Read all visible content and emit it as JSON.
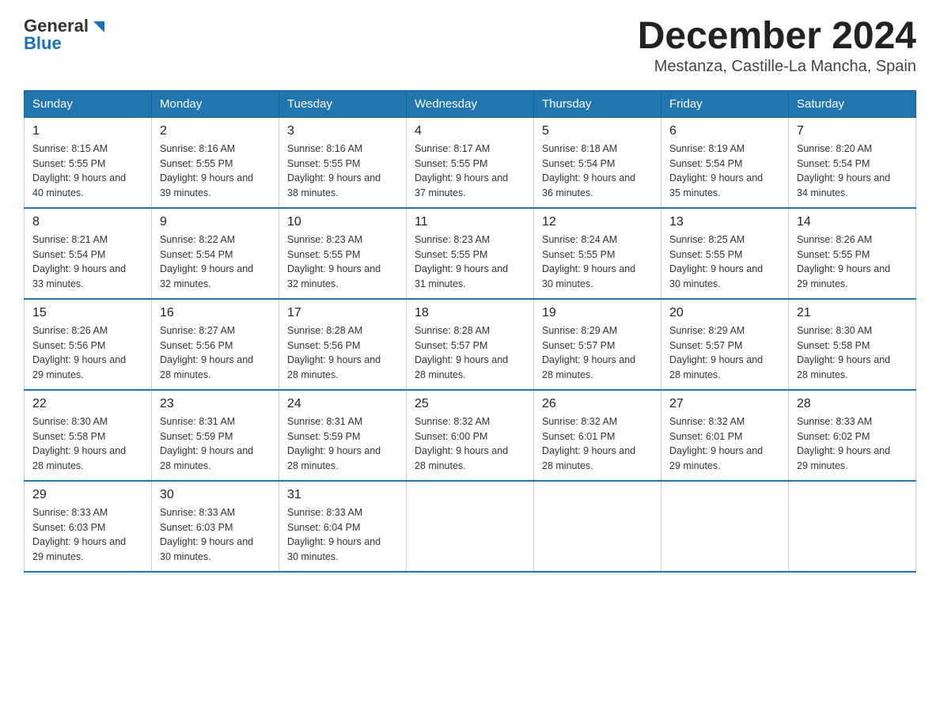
{
  "logo": {
    "text_general": "General",
    "text_blue": "Blue"
  },
  "title": "December 2024",
  "subtitle": "Mestanza, Castille-La Mancha, Spain",
  "days_of_week": [
    "Sunday",
    "Monday",
    "Tuesday",
    "Wednesday",
    "Thursday",
    "Friday",
    "Saturday"
  ],
  "weeks": [
    [
      {
        "day": "1",
        "sunrise": "8:15 AM",
        "sunset": "5:55 PM",
        "daylight": "9 hours and 40 minutes."
      },
      {
        "day": "2",
        "sunrise": "8:16 AM",
        "sunset": "5:55 PM",
        "daylight": "9 hours and 39 minutes."
      },
      {
        "day": "3",
        "sunrise": "8:16 AM",
        "sunset": "5:55 PM",
        "daylight": "9 hours and 38 minutes."
      },
      {
        "day": "4",
        "sunrise": "8:17 AM",
        "sunset": "5:55 PM",
        "daylight": "9 hours and 37 minutes."
      },
      {
        "day": "5",
        "sunrise": "8:18 AM",
        "sunset": "5:54 PM",
        "daylight": "9 hours and 36 minutes."
      },
      {
        "day": "6",
        "sunrise": "8:19 AM",
        "sunset": "5:54 PM",
        "daylight": "9 hours and 35 minutes."
      },
      {
        "day": "7",
        "sunrise": "8:20 AM",
        "sunset": "5:54 PM",
        "daylight": "9 hours and 34 minutes."
      }
    ],
    [
      {
        "day": "8",
        "sunrise": "8:21 AM",
        "sunset": "5:54 PM",
        "daylight": "9 hours and 33 minutes."
      },
      {
        "day": "9",
        "sunrise": "8:22 AM",
        "sunset": "5:54 PM",
        "daylight": "9 hours and 32 minutes."
      },
      {
        "day": "10",
        "sunrise": "8:23 AM",
        "sunset": "5:55 PM",
        "daylight": "9 hours and 32 minutes."
      },
      {
        "day": "11",
        "sunrise": "8:23 AM",
        "sunset": "5:55 PM",
        "daylight": "9 hours and 31 minutes."
      },
      {
        "day": "12",
        "sunrise": "8:24 AM",
        "sunset": "5:55 PM",
        "daylight": "9 hours and 30 minutes."
      },
      {
        "day": "13",
        "sunrise": "8:25 AM",
        "sunset": "5:55 PM",
        "daylight": "9 hours and 30 minutes."
      },
      {
        "day": "14",
        "sunrise": "8:26 AM",
        "sunset": "5:55 PM",
        "daylight": "9 hours and 29 minutes."
      }
    ],
    [
      {
        "day": "15",
        "sunrise": "8:26 AM",
        "sunset": "5:56 PM",
        "daylight": "9 hours and 29 minutes."
      },
      {
        "day": "16",
        "sunrise": "8:27 AM",
        "sunset": "5:56 PM",
        "daylight": "9 hours and 28 minutes."
      },
      {
        "day": "17",
        "sunrise": "8:28 AM",
        "sunset": "5:56 PM",
        "daylight": "9 hours and 28 minutes."
      },
      {
        "day": "18",
        "sunrise": "8:28 AM",
        "sunset": "5:57 PM",
        "daylight": "9 hours and 28 minutes."
      },
      {
        "day": "19",
        "sunrise": "8:29 AM",
        "sunset": "5:57 PM",
        "daylight": "9 hours and 28 minutes."
      },
      {
        "day": "20",
        "sunrise": "8:29 AM",
        "sunset": "5:57 PM",
        "daylight": "9 hours and 28 minutes."
      },
      {
        "day": "21",
        "sunrise": "8:30 AM",
        "sunset": "5:58 PM",
        "daylight": "9 hours and 28 minutes."
      }
    ],
    [
      {
        "day": "22",
        "sunrise": "8:30 AM",
        "sunset": "5:58 PM",
        "daylight": "9 hours and 28 minutes."
      },
      {
        "day": "23",
        "sunrise": "8:31 AM",
        "sunset": "5:59 PM",
        "daylight": "9 hours and 28 minutes."
      },
      {
        "day": "24",
        "sunrise": "8:31 AM",
        "sunset": "5:59 PM",
        "daylight": "9 hours and 28 minutes."
      },
      {
        "day": "25",
        "sunrise": "8:32 AM",
        "sunset": "6:00 PM",
        "daylight": "9 hours and 28 minutes."
      },
      {
        "day": "26",
        "sunrise": "8:32 AM",
        "sunset": "6:01 PM",
        "daylight": "9 hours and 28 minutes."
      },
      {
        "day": "27",
        "sunrise": "8:32 AM",
        "sunset": "6:01 PM",
        "daylight": "9 hours and 29 minutes."
      },
      {
        "day": "28",
        "sunrise": "8:33 AM",
        "sunset": "6:02 PM",
        "daylight": "9 hours and 29 minutes."
      }
    ],
    [
      {
        "day": "29",
        "sunrise": "8:33 AM",
        "sunset": "6:03 PM",
        "daylight": "9 hours and 29 minutes."
      },
      {
        "day": "30",
        "sunrise": "8:33 AM",
        "sunset": "6:03 PM",
        "daylight": "9 hours and 30 minutes."
      },
      {
        "day": "31",
        "sunrise": "8:33 AM",
        "sunset": "6:04 PM",
        "daylight": "9 hours and 30 minutes."
      },
      null,
      null,
      null,
      null
    ]
  ]
}
